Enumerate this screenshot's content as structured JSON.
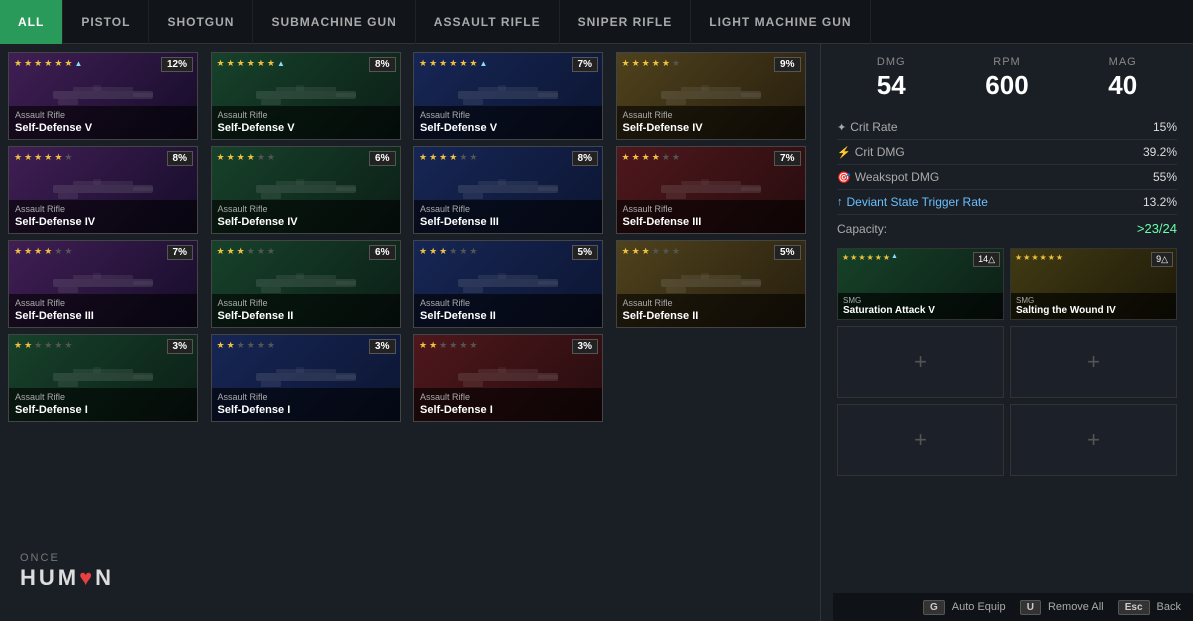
{
  "nav": {
    "tabs": [
      {
        "id": "all",
        "label": "ALL",
        "active": true
      },
      {
        "id": "pistol",
        "label": "PISTOL",
        "active": false
      },
      {
        "id": "shotgun",
        "label": "SHOTGUN",
        "active": false
      },
      {
        "id": "submachine-gun",
        "label": "SUBMACHINE GUN",
        "active": false
      },
      {
        "id": "assault-rifle",
        "label": "ASSAULT RIFLE",
        "active": false
      },
      {
        "id": "sniper-rifle",
        "label": "SNIPER RIFLE",
        "active": false
      },
      {
        "id": "light-machine-gun",
        "label": "LIGHT MACHINE GUN",
        "active": false
      }
    ]
  },
  "stats": {
    "dmg_label": "DMG",
    "dmg_value": "54",
    "rpm_label": "RPM",
    "rpm_value": "600",
    "mag_label": "MAG",
    "mag_value": "40"
  },
  "attributes": [
    {
      "icon": "✦",
      "label": "Crit Rate",
      "value": "15%",
      "link": false
    },
    {
      "icon": "⚡",
      "label": "Crit DMG",
      "value": "39.2%",
      "link": false
    },
    {
      "icon": "🎯",
      "label": "Weakspot DMG",
      "value": "55%",
      "link": false
    },
    {
      "icon": "↑",
      "label": "Deviant State Trigger Rate",
      "value": "13.2%",
      "link": true
    }
  ],
  "capacity": {
    "label": "Capacity:",
    "value": ">23/24"
  },
  "mod_slots": [
    {
      "filled": true,
      "type": "SMG",
      "name": "Saturation Attack V",
      "stars": 6,
      "up": true,
      "badge": "14△",
      "color": "smg-green"
    },
    {
      "filled": true,
      "type": "SMG",
      "name": "Salting the Wound IV",
      "stars": 6,
      "up": false,
      "badge": "9△",
      "color": "smg-yellow"
    },
    {
      "filled": false
    },
    {
      "filled": false
    },
    {
      "filled": false
    },
    {
      "filled": false
    }
  ],
  "weapons": [
    {
      "type": "Assault Rifle",
      "name": "Self-Defense V",
      "badge": "12%",
      "stars": 6,
      "color": "purple"
    },
    {
      "type": "Assault Rifle",
      "name": "Self-Defense V",
      "badge": "8%",
      "stars": 6,
      "color": "green"
    },
    {
      "type": "Assault Rifle",
      "name": "Self-Defense V",
      "badge": "7%",
      "stars": 6,
      "color": "blue"
    },
    {
      "type": "Assault Rifle",
      "name": "Self-Defense IV",
      "badge": "9%",
      "stars": 5,
      "color": "yellow"
    },
    {
      "type": "Assault Rifle",
      "name": "Self-Defense IV",
      "badge": "8%",
      "stars": 5,
      "color": "purple"
    },
    {
      "type": "Assault Rifle",
      "name": "Self-Defense IV",
      "badge": "6%",
      "stars": 4,
      "color": "green"
    },
    {
      "type": "Assault Rifle",
      "name": "Self-Defense III",
      "badge": "8%",
      "stars": 4,
      "color": "blue"
    },
    {
      "type": "Assault Rifle",
      "name": "Self-Defense III",
      "badge": "7%",
      "stars": 4,
      "color": "red"
    },
    {
      "type": "Assault Rifle",
      "name": "Self-Defense III",
      "badge": "7%",
      "stars": 4,
      "color": "purple"
    },
    {
      "type": "Assault Rifle",
      "name": "Self-Defense II",
      "badge": "6%",
      "stars": 3,
      "color": "green"
    },
    {
      "type": "Assault Rifle",
      "name": "Self-Defense II",
      "badge": "5%",
      "stars": 3,
      "color": "blue"
    },
    {
      "type": "Assault Rifle",
      "name": "Self-Defense II",
      "badge": "5%",
      "stars": 3,
      "color": "yellow"
    },
    {
      "type": "Assault Rifle",
      "name": "Self-Defense I",
      "badge": "3%",
      "stars": 2,
      "color": "green"
    },
    {
      "type": "Assault Rifle",
      "name": "Self-Defense I",
      "badge": "3%",
      "stars": 2,
      "color": "blue"
    },
    {
      "type": "Assault Rifle",
      "name": "Self-Defense I",
      "badge": "3%",
      "stars": 2,
      "color": "red"
    }
  ],
  "logo": {
    "once": "ONCE",
    "human": "HUM❤N"
  },
  "bottom_bar": {
    "auto_equip_key": "G",
    "auto_equip_label": "Auto Equip",
    "remove_all_key": "U",
    "remove_all_label": "Remove All",
    "back_key": "Esc",
    "back_label": "Back"
  }
}
